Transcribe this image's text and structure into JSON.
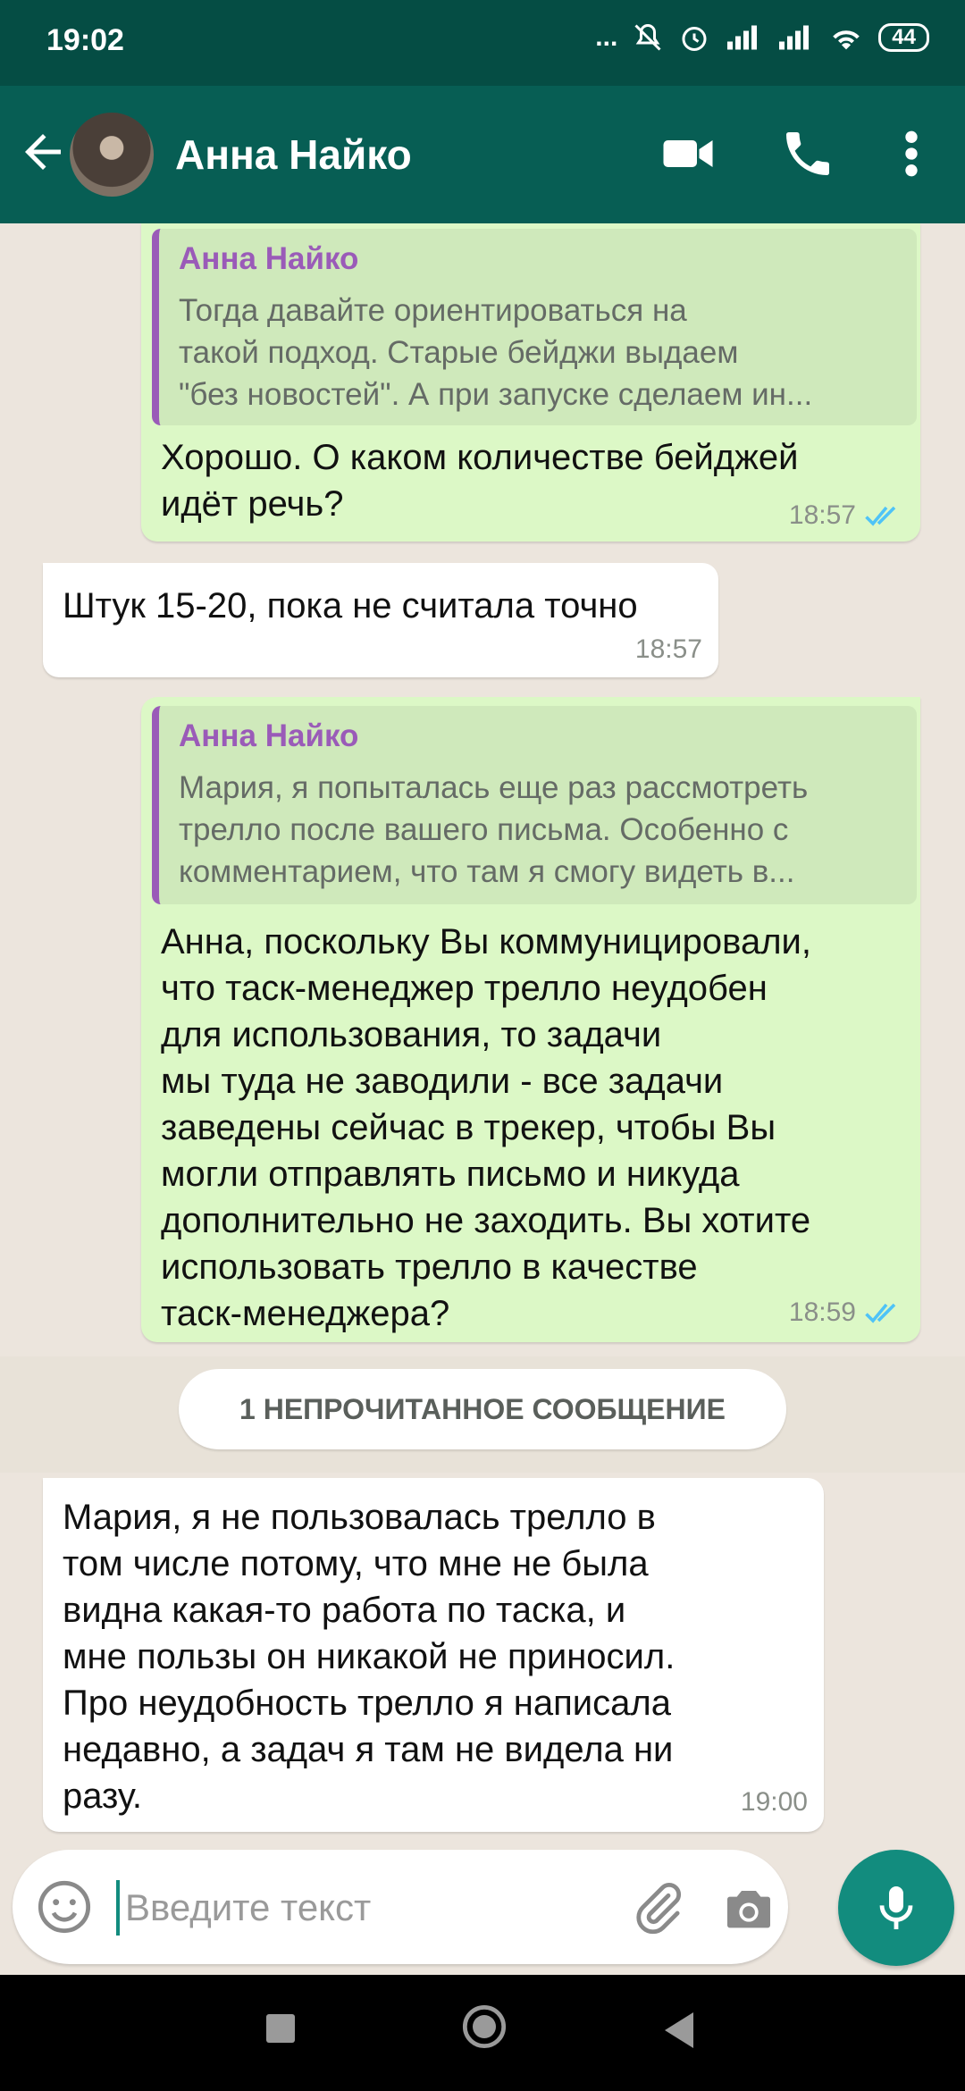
{
  "status_bar": {
    "time": "19:02",
    "battery": "44",
    "dots": "..."
  },
  "header": {
    "contact_name": "Анна Найко",
    "icons": [
      "back-arrow-icon",
      "video-call-icon",
      "phone-icon",
      "more-vert-icon"
    ]
  },
  "messages": [
    {
      "direction": "out",
      "quote_name": "Анна Найко",
      "quote_text": "Тогда давайте ориентироваться на\nтакой подход. Старые бейджи выдаем\n\"без новостей\". А при запуске сделаем ин...",
      "text": "Хорошо. О каком количестве бейджей\nидёт речь?",
      "time": "18:57",
      "read": true
    },
    {
      "direction": "in",
      "text": "Штук 15-20, пока не считала точно",
      "time": "18:57"
    },
    {
      "direction": "out",
      "quote_name": "Анна Найко",
      "quote_text": "Мария, я попыталась еще раз рассмотреть\nтрелло после вашего письма. Особенно с\nкомментарием, что там я смогу видеть в...",
      "text": "Анна, поскольку Вы коммуницировали,\nчто таск-менеджер трелло неудобен\nдля использования, то задачи\nмы туда не заводили - все задачи\nзаведены сейчас в трекер, чтобы Вы\nмогли отправлять письмо и никуда\nдополнительно не заходить. Вы хотите\nиспользовать трелло в качестве\nтаск-менеджера?",
      "time": "18:59",
      "read": true
    },
    {
      "direction": "in",
      "text": "Мария, я не пользовалась трелло в\nтом числе потому, что мне не была\nвидна какая-то работа по таска, и\nмне пользы он никакой не приносил.\nПро неудобность трелло я написала\nнедавно, а задач я там не видела ни\nразу.",
      "time": "19:00"
    }
  ],
  "unread_divider": "1 НЕПРОЧИТАННОЕ СООБЩЕНИЕ",
  "input": {
    "placeholder": "Введите текст",
    "value": ""
  },
  "colors": {
    "status_bar": "#054d44",
    "app_bar": "#075e54",
    "outgoing_bubble": "#dcf8c6",
    "incoming_bubble": "#ffffff",
    "quote_accent": "#9a5bb8",
    "read_ticks": "#4fc3f7",
    "mic_button": "#128c7e"
  }
}
